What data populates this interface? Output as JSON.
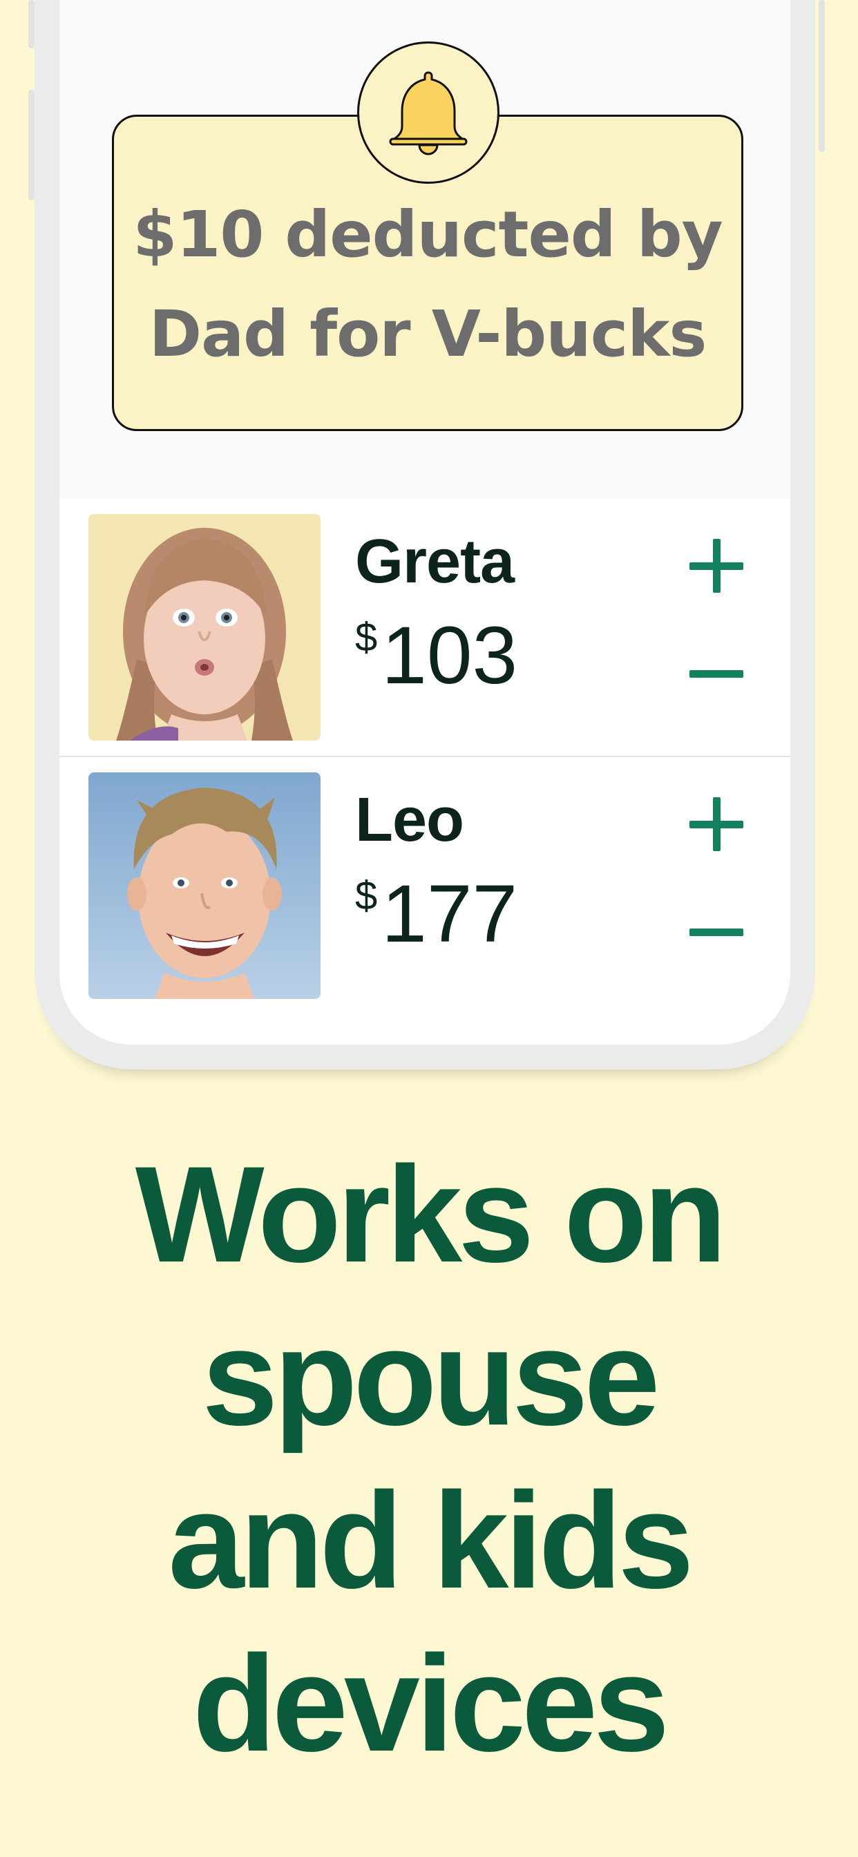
{
  "notification": {
    "line1": "$10 deducted by",
    "line2": "Dad for V-bucks",
    "icon": "bell-icon",
    "bell_color": "#f9d35e",
    "card_color": "#fbf3c6"
  },
  "kids": [
    {
      "name": "Greta",
      "currency": "$",
      "amount": "103",
      "avatar": "girl-photo",
      "add_icon": "plus-icon",
      "remove_icon": "minus-icon"
    },
    {
      "name": "Leo",
      "currency": "$",
      "amount": "177",
      "avatar": "boy-photo",
      "add_icon": "plus-icon",
      "remove_icon": "minus-icon"
    }
  ],
  "tagline": {
    "line1": "Works on",
    "line2": "spouse",
    "line3": "and kids",
    "line4": "devices"
  },
  "colors": {
    "background": "#fdf8d2",
    "accent_green": "#0b5a3c",
    "button_green": "#148060",
    "text_dark": "#0d241a",
    "notification_text": "#6d6d6d"
  }
}
